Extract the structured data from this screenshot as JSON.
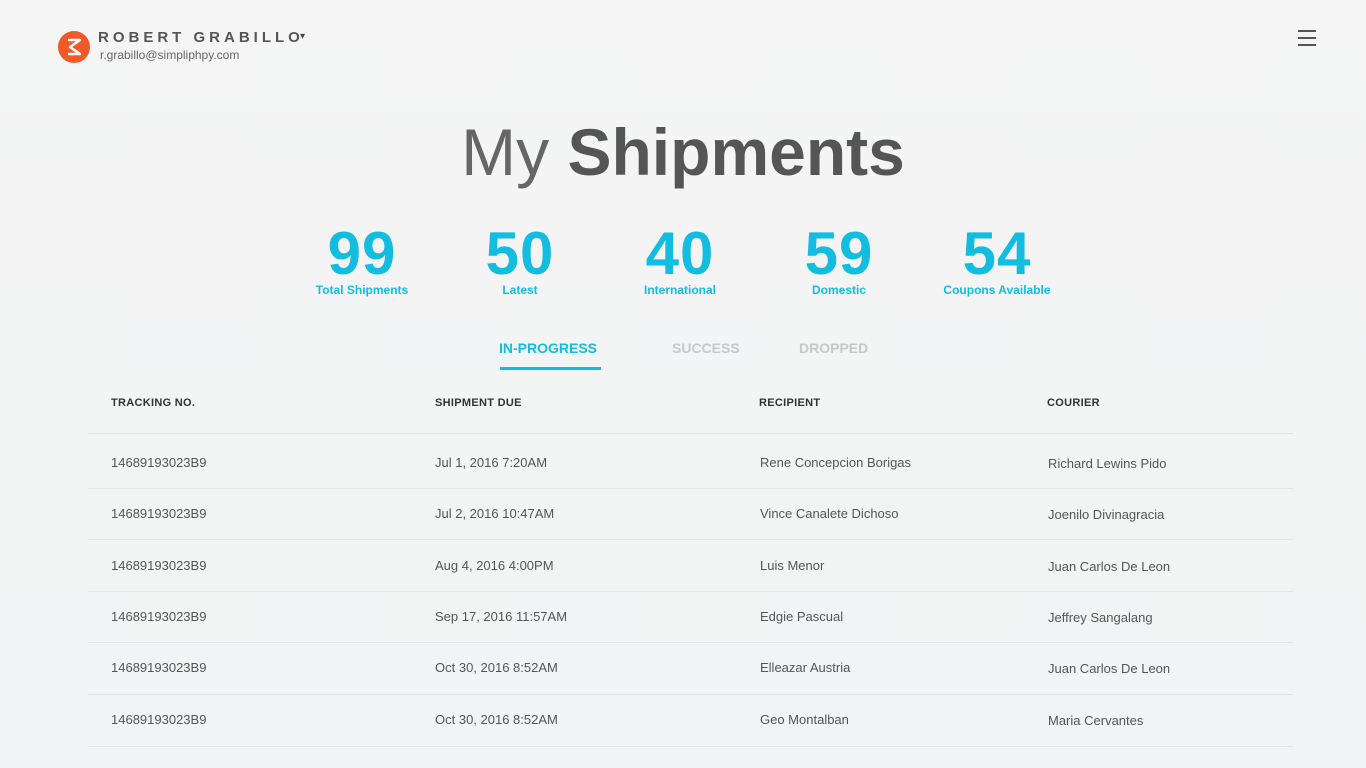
{
  "header": {
    "user_name": "ROBERT GRABILLO",
    "user_caret": "▾",
    "user_email": "r.grabillo@simpliphpy.com",
    "logo_icon": "hourglass-logo-icon",
    "menu_icon": "hamburger-menu-icon",
    "brand_color": "#f05a28"
  },
  "page": {
    "title_light": "My",
    "title_bold": "Shipments"
  },
  "stats": [
    {
      "value": "99",
      "label": "Total Shipments"
    },
    {
      "value": "50",
      "label": "Latest"
    },
    {
      "value": "40",
      "label": "International"
    },
    {
      "value": "59",
      "label": "Domestic"
    },
    {
      "value": "54",
      "label": "Coupons Available"
    }
  ],
  "accent_color": "#12bde0",
  "tabs": [
    {
      "label": "IN-PROGRESS",
      "active": true
    },
    {
      "label": "SUCCESS",
      "active": false
    },
    {
      "label": "DROPPED",
      "active": false
    }
  ],
  "table": {
    "columns": [
      "TRACKING NO.",
      "SHIPMENT DUE",
      "RECIPIENT",
      "COURIER"
    ],
    "rows": [
      [
        "14689193023B9",
        "Jul 1, 2016 7:20AM",
        "Rene Concepcion Borigas",
        "Richard Lewins Pido"
      ],
      [
        "14689193023B9",
        "Jul 2, 2016 10:47AM",
        "Vince Canalete Dichoso",
        "Joenilo Divinagracia"
      ],
      [
        "14689193023B9",
        "Aug 4, 2016 4:00PM",
        "Luis Menor",
        "Juan Carlos De Leon"
      ],
      [
        "14689193023B9",
        "Sep 17, 2016 11:57AM",
        "Edgie Pascual",
        "Jeffrey Sangalang"
      ],
      [
        "14689193023B9",
        "Oct 30, 2016 8:52AM",
        "Elleazar Austria",
        "Juan Carlos De Leon"
      ],
      [
        "14689193023B9",
        "Oct 30, 2016 8:52AM",
        "Geo Montalban",
        "Maria Cervantes"
      ]
    ]
  }
}
